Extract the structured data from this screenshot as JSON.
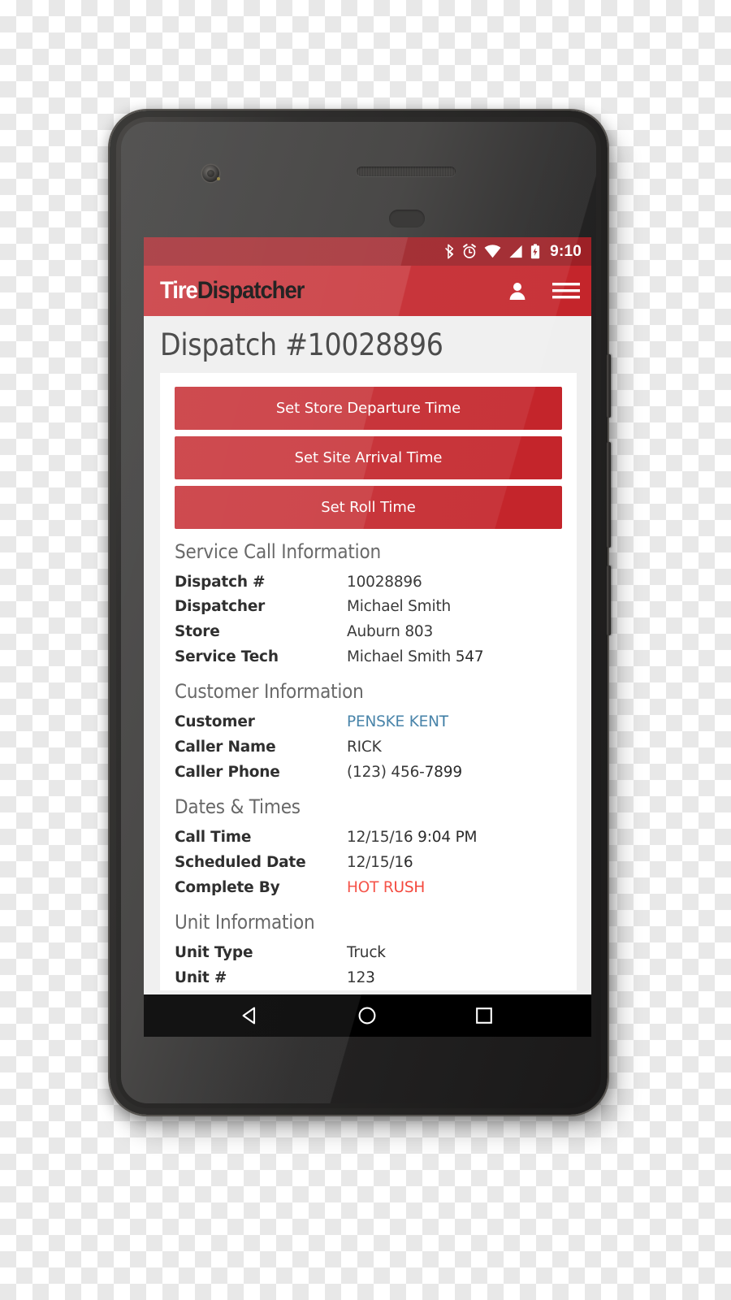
{
  "statusbar": {
    "time": "9:10",
    "icons": [
      "bluetooth-icon",
      "alarm-icon",
      "wifi-icon",
      "cell-signal-icon",
      "battery-charging-icon"
    ]
  },
  "appbar": {
    "brand_first": "Tire",
    "brand_second": "Dispatcher",
    "account_icon": "person-icon",
    "menu_icon": "hamburger-menu-icon"
  },
  "page": {
    "title": "Dispatch #10028896"
  },
  "actions": [
    {
      "label": "Set Store Departure Time"
    },
    {
      "label": "Set Site Arrival Time"
    },
    {
      "label": "Set Roll Time"
    }
  ],
  "sections": [
    {
      "heading": "Service Call Information",
      "fields": [
        {
          "label": "Dispatch #",
          "value": "10028896",
          "style": "plain"
        },
        {
          "label": "Dispatcher",
          "value": "Michael Smith",
          "style": "plain"
        },
        {
          "label": "Store",
          "value": "Auburn 803",
          "style": "plain"
        },
        {
          "label": "Service Tech",
          "value": "Michael Smith 547",
          "style": "plain"
        }
      ]
    },
    {
      "heading": "Customer Information",
      "fields": [
        {
          "label": "Customer",
          "value": "PENSKE KENT",
          "style": "link"
        },
        {
          "label": "Caller Name",
          "value": "RICK",
          "style": "plain"
        },
        {
          "label": "Caller Phone",
          "value": "(123) 456-7899",
          "style": "plain"
        }
      ]
    },
    {
      "heading": "Dates & Times",
      "fields": [
        {
          "label": "Call Time",
          "value": "12/15/16 9:04 PM",
          "style": "plain"
        },
        {
          "label": "Scheduled Date",
          "value": "12/15/16",
          "style": "plain"
        },
        {
          "label": "Complete By",
          "value": "HOT RUSH",
          "style": "alert"
        }
      ]
    },
    {
      "heading": "Unit Information",
      "fields": [
        {
          "label": "Unit Type",
          "value": "Truck",
          "style": "plain"
        },
        {
          "label": "Unit #",
          "value": "123",
          "style": "plain"
        }
      ]
    }
  ],
  "navbar": {
    "back_icon": "triangle-back-icon",
    "home_icon": "circle-home-icon",
    "recents_icon": "square-recents-icon"
  },
  "colors": {
    "brand_red": "#c4252b",
    "statusbar_red": "#9d2026",
    "link_blue": "#3b7ba3",
    "alert_red": "#f4473c",
    "page_bg": "#efefef"
  }
}
